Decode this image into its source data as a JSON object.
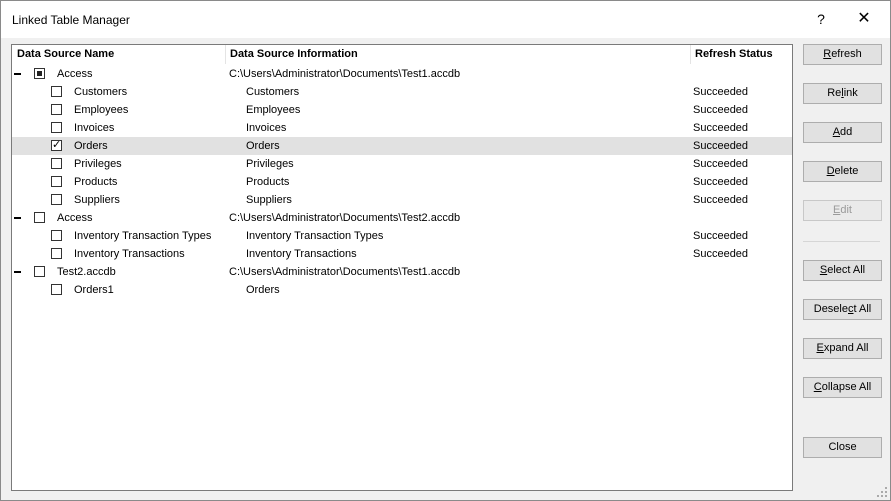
{
  "window": {
    "title": "Linked Table Manager",
    "help_glyph": "?",
    "close_glyph": "✕"
  },
  "columns": {
    "name": "Data Source Name",
    "info": "Data Source Information",
    "status": "Refresh Status"
  },
  "rows": [
    {
      "kind": "group",
      "name": "Access",
      "info": "C:\\Users\\Administrator\\Documents\\Test1.accdb",
      "status": "",
      "check": "partial"
    },
    {
      "kind": "item",
      "name": "Customers",
      "info": "Customers",
      "status": "Succeeded",
      "check": "unchecked"
    },
    {
      "kind": "item",
      "name": "Employees",
      "info": "Employees",
      "status": "Succeeded",
      "check": "unchecked"
    },
    {
      "kind": "item",
      "name": "Invoices",
      "info": "Invoices",
      "status": "Succeeded",
      "check": "unchecked"
    },
    {
      "kind": "item",
      "name": "Orders",
      "info": "Orders",
      "status": "Succeeded",
      "check": "checked",
      "selected": true
    },
    {
      "kind": "item",
      "name": "Privileges",
      "info": "Privileges",
      "status": "Succeeded",
      "check": "unchecked"
    },
    {
      "kind": "item",
      "name": "Products",
      "info": "Products",
      "status": "Succeeded",
      "check": "unchecked"
    },
    {
      "kind": "item",
      "name": "Suppliers",
      "info": "Suppliers",
      "status": "Succeeded",
      "check": "unchecked"
    },
    {
      "kind": "group",
      "name": "Access",
      "info": "C:\\Users\\Administrator\\Documents\\Test2.accdb",
      "status": "",
      "check": "unchecked"
    },
    {
      "kind": "item",
      "name": "Inventory Transaction Types",
      "info": "Inventory Transaction Types",
      "status": "Succeeded",
      "check": "unchecked"
    },
    {
      "kind": "item",
      "name": "Inventory Transactions",
      "info": "Inventory Transactions",
      "status": "Succeeded",
      "check": "unchecked"
    },
    {
      "kind": "group",
      "name": "Test2.accdb",
      "info": "C:\\Users\\Administrator\\Documents\\Test1.accdb",
      "status": "",
      "check": "unchecked"
    },
    {
      "kind": "item",
      "name": "Orders1",
      "info": "Orders",
      "status": "",
      "check": "unchecked"
    }
  ],
  "buttons": {
    "refresh": {
      "pre": "",
      "key": "R",
      "post": "efresh"
    },
    "relink": {
      "pre": "Re",
      "key": "l",
      "post": "ink"
    },
    "add": {
      "pre": "",
      "key": "A",
      "post": "dd"
    },
    "delete": {
      "pre": "",
      "key": "D",
      "post": "elete"
    },
    "edit": {
      "pre": "",
      "key": "E",
      "post": "dit",
      "disabled": true
    },
    "select_all": {
      "pre": "",
      "key": "S",
      "post": "elect All"
    },
    "deselect_all": {
      "pre": "Desele",
      "key": "c",
      "post": "t All"
    },
    "expand_all": {
      "pre": "",
      "key": "E",
      "post": "xpand All"
    },
    "collapse_all": {
      "pre": "",
      "key": "C",
      "post": "ollapse All"
    },
    "close": {
      "pre": "Close",
      "key": "",
      "post": ""
    }
  }
}
